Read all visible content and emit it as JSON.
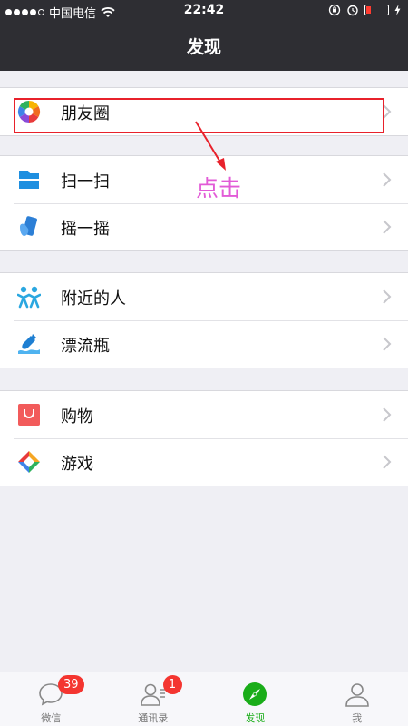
{
  "status_bar": {
    "carrier": "中国电信",
    "time": "22:42"
  },
  "nav": {
    "title": "发现"
  },
  "groups": [
    [
      {
        "label": "朋友圈",
        "icon": "moments-icon"
      }
    ],
    [
      {
        "label": "扫一扫",
        "icon": "scan-icon"
      },
      {
        "label": "摇一摇",
        "icon": "shake-icon"
      }
    ],
    [
      {
        "label": "附近的人",
        "icon": "people-nearby-icon"
      },
      {
        "label": "漂流瓶",
        "icon": "drift-bottle-icon"
      }
    ],
    [
      {
        "label": "购物",
        "icon": "shopping-icon"
      },
      {
        "label": "游戏",
        "icon": "games-icon"
      }
    ]
  ],
  "annotation": {
    "text": "点击",
    "color": "#e25bd7",
    "box_color": "#e8212b"
  },
  "tabs": [
    {
      "label": "微信",
      "badge": "39",
      "icon": "chat-icon"
    },
    {
      "label": "通讯录",
      "badge": "1",
      "icon": "contacts-icon"
    },
    {
      "label": "发现",
      "icon": "compass-icon",
      "active": true
    },
    {
      "label": "我",
      "icon": "me-icon"
    }
  ],
  "colors": {
    "accent": "#1aad19",
    "header": "#2e2e33",
    "badge": "#f43530"
  }
}
